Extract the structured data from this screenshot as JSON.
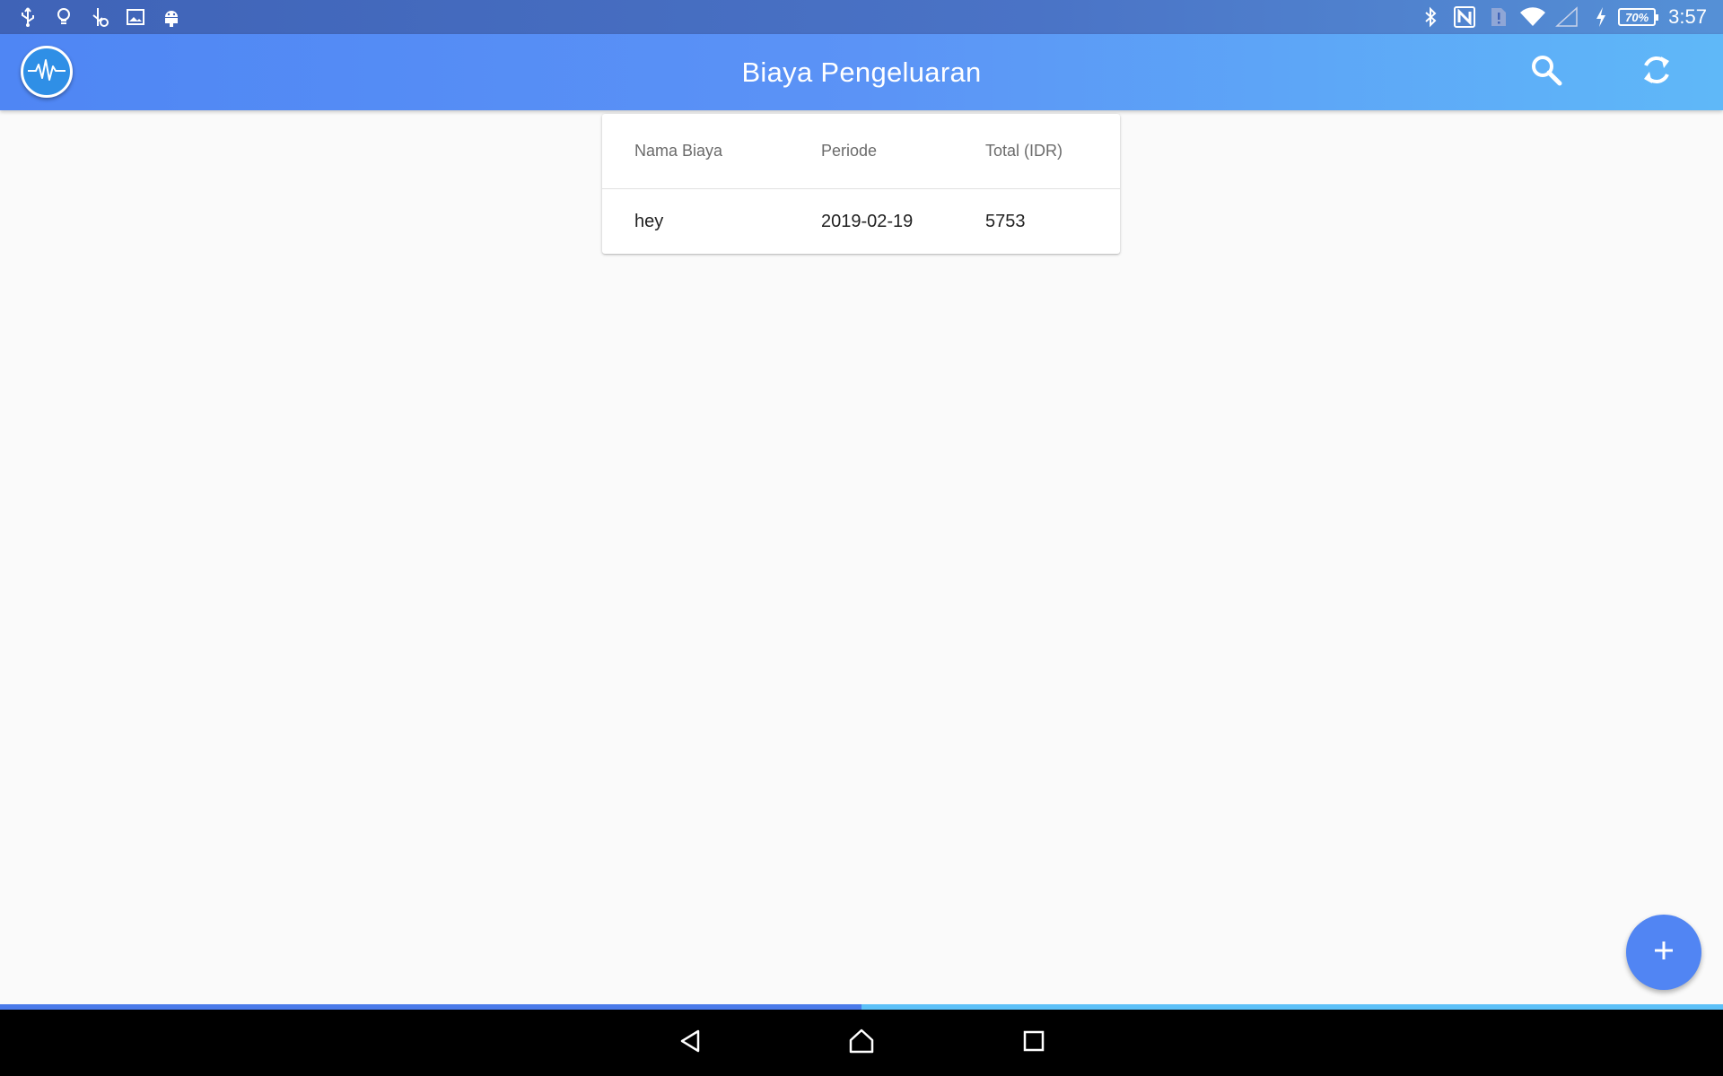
{
  "status_bar": {
    "left_icons": [
      "usb-icon",
      "lightbulb-icon",
      "usb-debug-icon",
      "image-icon",
      "android-icon"
    ],
    "right_icons": [
      "bluetooth-icon",
      "nfc-icon",
      "sim-alert-icon",
      "wifi-icon",
      "cell-signal-icon",
      "charging-icon"
    ],
    "battery": "70%",
    "time": "3:57"
  },
  "app_bar": {
    "title": "Biaya Pengeluaran",
    "logo_icon": "heartbeat-icon",
    "actions": [
      "search-icon",
      "sync-icon"
    ],
    "color_start": "#4f86f4",
    "color_end": "#5fb8f8"
  },
  "table": {
    "columns": [
      "Nama Biaya",
      "Periode",
      "Total (IDR)"
    ],
    "rows": [
      [
        "hey",
        "2019-02-19",
        "5753"
      ]
    ]
  },
  "fab": {
    "icon": "plus-icon",
    "color": "#5185f3"
  },
  "progress": {
    "value": 0.5
  },
  "nav_bar": {
    "buttons": [
      "back-icon",
      "home-icon",
      "recent-apps-icon"
    ]
  }
}
